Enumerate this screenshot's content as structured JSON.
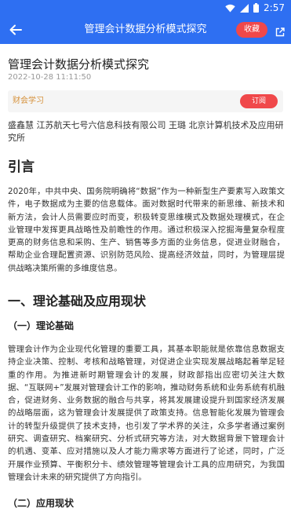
{
  "status_bar": {
    "time": "2:57"
  },
  "app_bar": {
    "title": "管理会计数据分析模式探究",
    "collect_label": "收藏",
    "icons": [
      "back-arrow-icon",
      "share-icon"
    ]
  },
  "article": {
    "title": "管理会计数据分析模式探究",
    "date": "2022-10-28 11:11:50",
    "subscribe": {
      "label": "财会学习",
      "button": "订阅"
    },
    "authors": "盛鑫慧 江苏航天七号六信息科技有限公司 王璐 北京计算机技术及应用研究所",
    "intro_heading": "引言",
    "intro_paragraph": "2020年，中共中央、国务院明确将“数据”作为一种新型生产要素写入政策文件，电子数据成为主要的信息载体。面对数据时代带来的新思维、新技术和新方法，会计人员需要应时而变，积极转变思维模式及数据处理模式，在企业管理中发挥更具战略性及前瞻性的作用。通过积极深入挖掘海量复杂程度更高的财务信息和采购、生产、销售等多方面的业务信息，促进业财融合，帮助企业合理配置资源、识别防范风险、提高经济效益，同时，为管理层提供战略决策所需的多维度信息。",
    "section1_heading": "一、理论基础及应用现状",
    "sub1_heading": "（一）理论基础",
    "sub1_paragraph": "管理会计作为企业现代化管理的重要工具，其基本职能就是依靠信息数据支持企业决策、控制、考核和战略管理，对促进企业实现发展战略起着举足轻重的作用。为推进新时期管理会计的发展，财政部指出应密切关注大数据、“互联网+”发展对管理会计工作的影响，推动财务系统和业务系统有机融合，促进财务、业务数据的融合与共享，将其发展建设提升到国家经济发展的战略层面，这为管理会计发展提供了政策支持。信息智能化发展为管理会计的转型升级提供了技术支持，也引发了学术界的关注，众多学者通过案例研究、调查研究、档案研究、分析式研究等方法，对大数据背景下管理会计的机遇、变革、应对措施以及人才能力需求等方面进行了论述，同时，广泛开展作业预算、平衡积分卡、绩效管理等管理会计工具的应用研究，为我国管理会计未来的研究提供了方向指引。",
    "sub2_heading": "（二）应用现状"
  }
}
